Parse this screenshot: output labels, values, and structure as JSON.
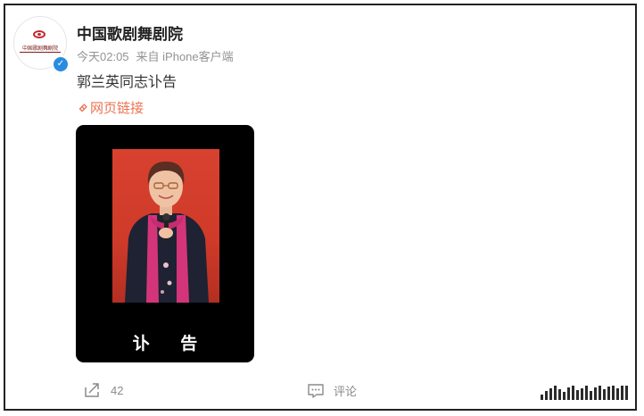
{
  "post": {
    "author": "中国歌剧舞剧院",
    "time": "今天02:05",
    "source": "来自 iPhone客户端",
    "text": "郭兰英同志讣告",
    "link_label": "网页链接",
    "avatar_text": "中国歌剧舞剧院",
    "card_caption": "讣 告"
  },
  "actions": {
    "share_count": "42",
    "comment_label": "评论"
  },
  "colors": {
    "link": "#eb7350",
    "verified": "#2a8ce0",
    "meta": "#939393"
  }
}
